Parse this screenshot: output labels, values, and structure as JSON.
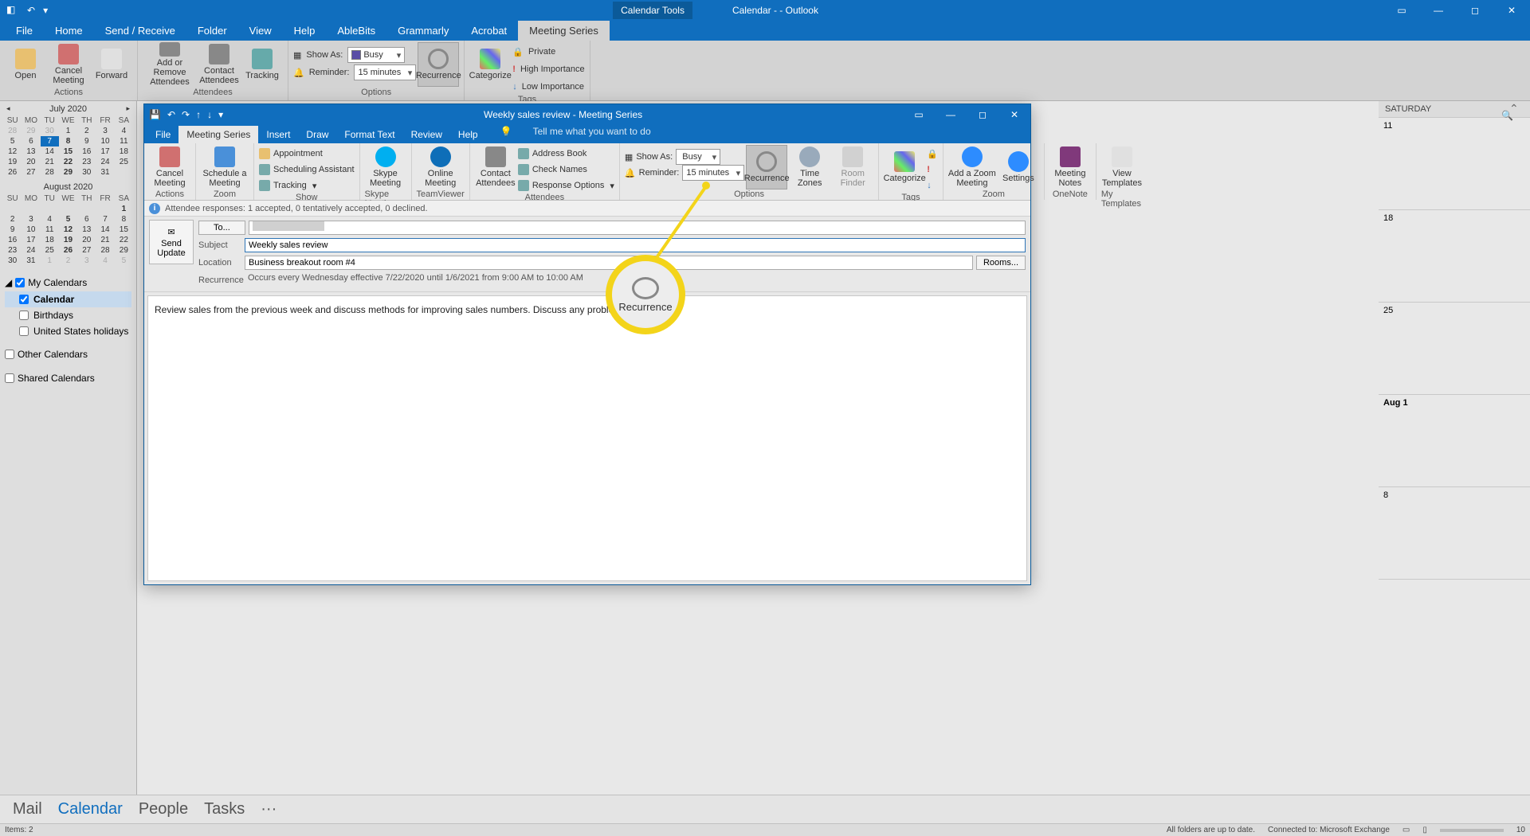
{
  "titlebar": {
    "tool_tab": "Calendar Tools",
    "app_title": "Calendar -                                   - Outlook"
  },
  "main_tabs": [
    "File",
    "Home",
    "Send / Receive",
    "Folder",
    "View",
    "Help",
    "AbleBits",
    "Grammarly",
    "Acrobat",
    "Meeting Series"
  ],
  "main_active": 9,
  "ribbon": {
    "actions": {
      "open": "Open",
      "cancel": "Cancel Meeting",
      "forward": "Forward",
      "group": "Actions"
    },
    "attendees": {
      "addremove": "Add or Remove Attendees",
      "contact": "Contact Attendees",
      "tracking": "Tracking",
      "group": "Attendees"
    },
    "options": {
      "showas_lbl": "Show As:",
      "showas_val": "Busy",
      "reminder_lbl": "Reminder:",
      "reminder_val": "15 minutes",
      "recurrence": "Recurrence",
      "group": "Options"
    },
    "categorize": "Categorize",
    "tags": {
      "private": "Private",
      "high": "High Importance",
      "low": "Low Importance",
      "group": "Tags"
    }
  },
  "calendars_july": {
    "title": "July 2020",
    "dow": [
      "SU",
      "MO",
      "TU",
      "WE",
      "TH",
      "FR",
      "SA"
    ],
    "rows": [
      [
        "28",
        "29",
        "30",
        "1",
        "2",
        "3",
        "4"
      ],
      [
        "5",
        "6",
        "7",
        "8",
        "9",
        "10",
        "11"
      ],
      [
        "12",
        "13",
        "14",
        "15",
        "16",
        "17",
        "18"
      ],
      [
        "19",
        "20",
        "21",
        "22",
        "23",
        "24",
        "25"
      ],
      [
        "26",
        "27",
        "28",
        "29",
        "30",
        "31",
        ""
      ]
    ],
    "selected": "7"
  },
  "calendars_aug": {
    "title": "August 2020",
    "dow": [
      "SU",
      "MO",
      "TU",
      "WE",
      "TH",
      "FR",
      "SA"
    ],
    "rows": [
      [
        "",
        "",
        "",
        "",
        "",
        "",
        "1"
      ],
      [
        "2",
        "3",
        "4",
        "5",
        "6",
        "7",
        "8"
      ],
      [
        "9",
        "10",
        "11",
        "12",
        "13",
        "14",
        "15"
      ],
      [
        "16",
        "17",
        "18",
        "19",
        "20",
        "21",
        "22"
      ],
      [
        "23",
        "24",
        "25",
        "26",
        "27",
        "28",
        "29"
      ],
      [
        "30",
        "31",
        "1",
        "2",
        "3",
        "4",
        "5"
      ]
    ]
  },
  "cal_groups": {
    "my": "My Calendars",
    "cal": "Calendar",
    "bday": "Birthdays",
    "hol": "United States holidays",
    "other": "Other Calendars",
    "shared": "Shared Calendars"
  },
  "satcol": {
    "hdr": "SATURDAY",
    "d1": "11",
    "d2": "18",
    "d3": "25",
    "d4": "Aug 1",
    "d5": "8"
  },
  "mw": {
    "title": "Weekly sales review  -  Meeting Series",
    "tabs": [
      "File",
      "Meeting Series",
      "Insert",
      "Draw",
      "Format Text",
      "Review",
      "Help"
    ],
    "active": 1,
    "tellme": "Tell me what you want to do",
    "ribbon": {
      "cancel": "Cancel Meeting",
      "group_actions": "Actions",
      "schedule": "Schedule a Meeting",
      "group_zoom": "Zoom",
      "appointment": "Appointment",
      "schedass": "Scheduling Assistant",
      "tracking": "Tracking",
      "group_show": "Show",
      "skype": "Skype Meeting",
      "group_skype": "Skype Meeti...",
      "online": "Online Meeting",
      "group_tv": "TeamViewer",
      "contact": "Contact Attendees",
      "group_att": "Attendees",
      "addrbook": "Address Book",
      "chknames": "Check Names",
      "respopt": "Response Options",
      "showas_lbl": "Show As:",
      "showas_val": "Busy",
      "reminder_lbl": "Reminder:",
      "reminder_val": "15 minutes",
      "recurrence": "Recurrence",
      "tz": "Time Zones",
      "room": "Room Finder",
      "group_opt": "Options",
      "categorize": "Categorize",
      "group_tags": "Tags",
      "addzoom": "Add a Zoom Meeting",
      "settings": "Settings",
      "group_zoom2": "Zoom",
      "notes": "Meeting Notes",
      "group_on": "OneNote",
      "viewtpl": "View Templates",
      "group_tpl": "My Templates"
    },
    "status": "Attendee responses: 1 accepted, 0 tentatively accepted, 0 declined.",
    "send": "Send Update",
    "to": "To...",
    "subject_lbl": "Subject",
    "subject_val": "Weekly sales review",
    "loc_lbl": "Location",
    "loc_val": "Business breakout room #4",
    "rooms": "Rooms...",
    "rec_lbl": "Recurrence",
    "rec_val": "Occurs every Wednesday effective 7/22/2020 until 1/6/2021 from 9:00 AM to 10:00 AM",
    "body": "Review sales from the previous week and discuss methods for improving sales numbers. Discuss any problematic situation"
  },
  "callout": "Recurrence",
  "nav": [
    "Mail",
    "Calendar",
    "People",
    "Tasks"
  ],
  "nav_active": 1,
  "status_left": "Items: 2",
  "status_mid": "All folders are up to date.",
  "status_right": "Connected to: Microsoft Exchange",
  "status_zoom": "10"
}
